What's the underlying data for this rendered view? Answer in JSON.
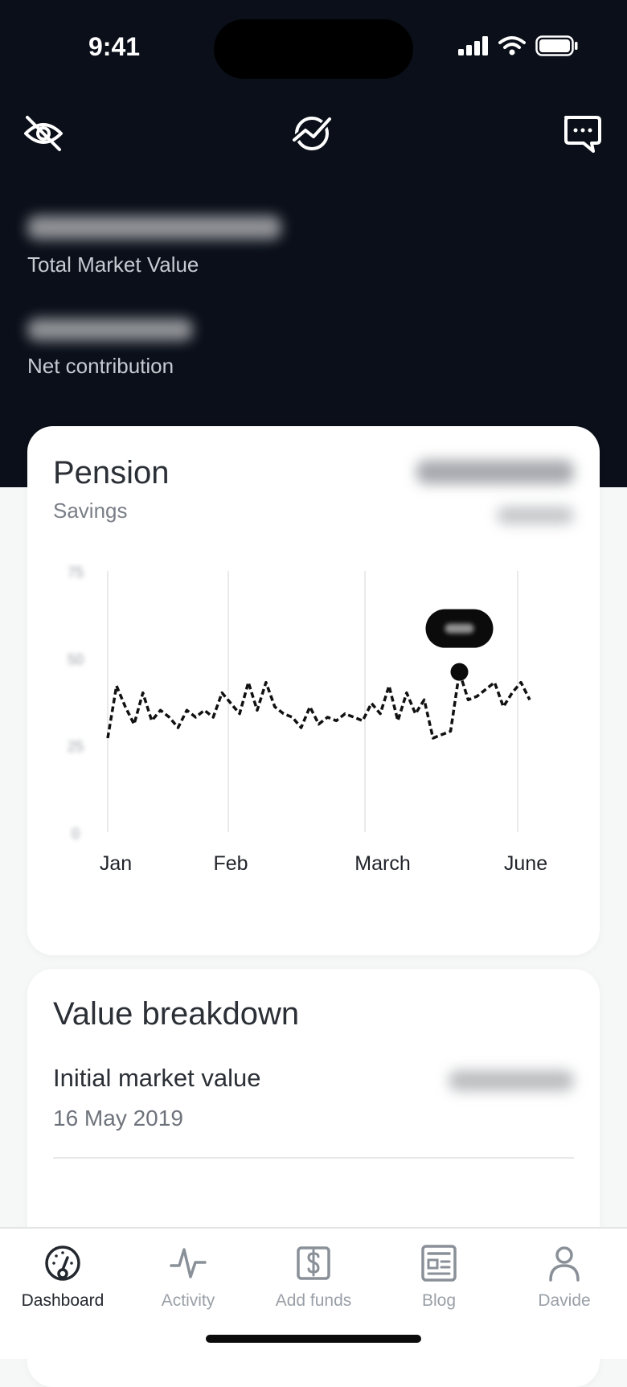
{
  "status": {
    "time": "9:41"
  },
  "hero": {
    "total_label": "Total Market Value",
    "net_label": "Net contribution"
  },
  "pension": {
    "title": "Pension",
    "subtitle": "Savings"
  },
  "chart_data": {
    "type": "line",
    "x_tick_labels": [
      "Jan",
      "Feb",
      "March",
      "June"
    ],
    "y_tick_values": [
      0,
      25,
      50,
      75
    ],
    "ylim": [
      0,
      75
    ],
    "grid": "vertical",
    "series": [
      {
        "values": [
          27,
          42,
          36,
          31,
          40,
          32,
          35,
          33,
          30,
          35,
          33,
          35,
          33,
          40,
          37,
          34,
          43,
          35,
          43,
          36,
          34,
          33,
          30,
          36,
          31,
          33,
          32,
          34,
          33,
          32,
          37,
          34,
          42,
          32,
          40,
          34,
          38,
          27,
          28,
          29,
          46,
          38,
          39,
          41,
          43,
          36,
          40,
          43,
          38
        ],
        "highlight_index": 40
      }
    ]
  },
  "breakdown": {
    "title": "Value breakdown",
    "rows": [
      {
        "label": "Initial market value",
        "date": "16 May 2019"
      }
    ]
  },
  "tabs": [
    {
      "label": "Dashboard",
      "icon": "dashboard-icon",
      "active": true
    },
    {
      "label": "Activity",
      "icon": "activity-icon"
    },
    {
      "label": "Add funds",
      "icon": "add-funds-icon"
    },
    {
      "label": "Blog",
      "icon": "blog-icon"
    },
    {
      "label": "Davide",
      "icon": "profile-icon"
    }
  ]
}
